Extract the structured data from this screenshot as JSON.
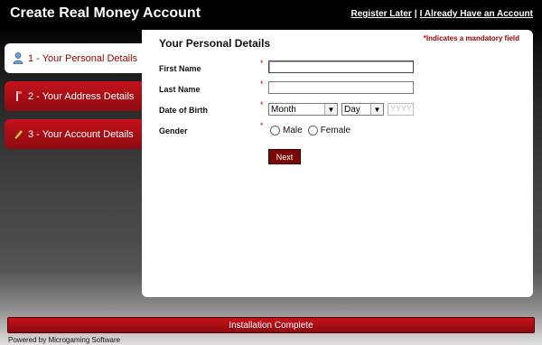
{
  "header": {
    "title": "Create Real Money Account",
    "links": {
      "register_later": "Register Later",
      "separator": "|",
      "already_have": "I Already Have an Account"
    }
  },
  "steps": [
    {
      "label": "1 - Your Personal Details",
      "icon": "user-icon",
      "active": true
    },
    {
      "label": "2 - Your Address Details",
      "icon": "mailbox-icon",
      "active": false
    },
    {
      "label": "3 - Your Account Details",
      "icon": "pencil-icon",
      "active": false
    }
  ],
  "form": {
    "title": "Your Personal Details",
    "mandatory_note_star": "*",
    "mandatory_note": "Indicates a mandatory field",
    "required_marker": "*",
    "first_name": {
      "label": "First Name",
      "value": ""
    },
    "last_name": {
      "label": "Last Name",
      "value": ""
    },
    "dob": {
      "label": "Date of Birth",
      "month": "Month",
      "day": "Day",
      "year_placeholder": "YYYY"
    },
    "gender": {
      "label": "Gender",
      "male": "Male",
      "female": "Female"
    },
    "next": "Next"
  },
  "footer": {
    "status": "Installation Complete",
    "powered_by": "Powered by Microgaming Software"
  },
  "colors": {
    "accent": "#9a0000",
    "brand_red": "#c4121b",
    "button_dark_red": "#7a0606"
  }
}
